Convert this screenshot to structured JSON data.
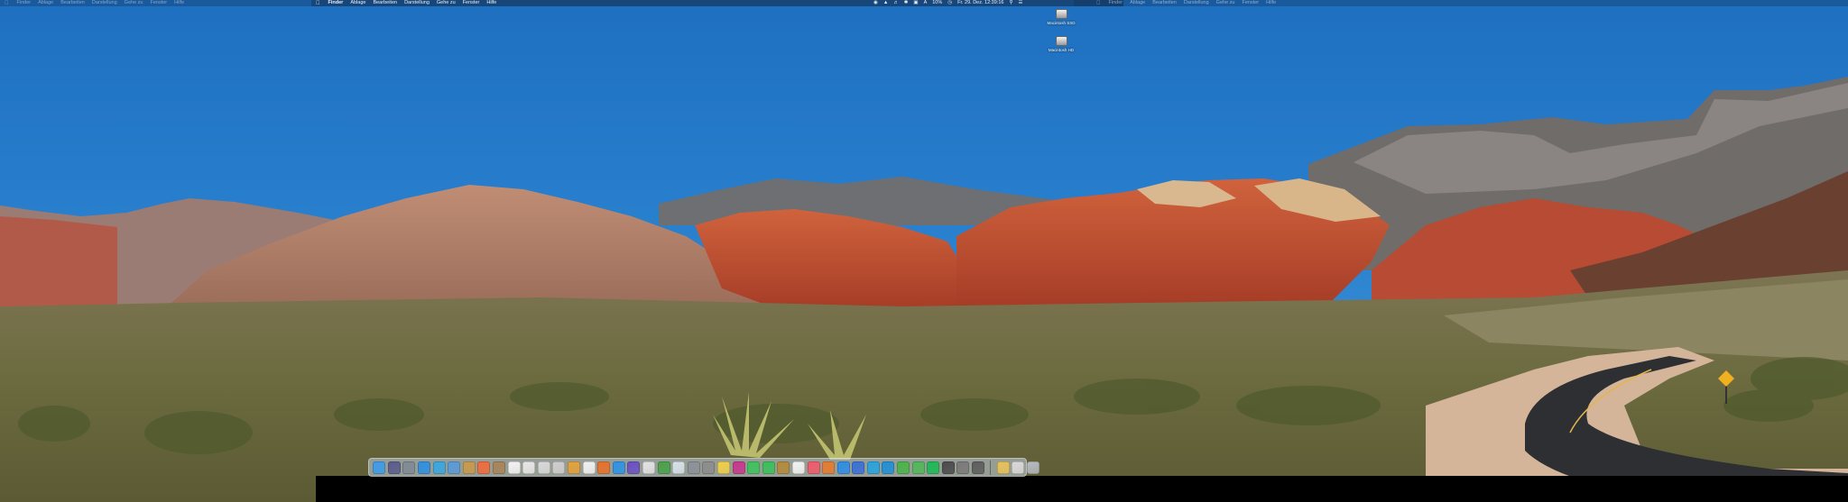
{
  "menubar": {
    "app_menu": "Finder",
    "items": [
      "Ablage",
      "Bearbeiten",
      "Darstellung",
      "Gehe zu",
      "Fenster",
      "Hilfe"
    ],
    "status": {
      "battery": "10%",
      "datetime": "Fr. 29. Dez. 12:39:16",
      "input": "A"
    }
  },
  "desktop": {
    "drives": [
      {
        "label": "Macintosh SSD",
        "icon": "hard-drive-icon"
      },
      {
        "label": "Macintosh HD",
        "icon": "hard-drive-icon"
      }
    ]
  },
  "dock": {
    "apps": [
      {
        "name": "finder",
        "color": "#3d9be9"
      },
      {
        "name": "siri",
        "color": "#5b5b8a"
      },
      {
        "name": "launchpad",
        "color": "#7f8a96"
      },
      {
        "name": "safari",
        "color": "#2f8fe0"
      },
      {
        "name": "safari-2",
        "color": "#3aa6df"
      },
      {
        "name": "mail",
        "color": "#5a9ad8"
      },
      {
        "name": "contacts",
        "color": "#c89a4c"
      },
      {
        "name": "reminders",
        "color": "#f06b3c"
      },
      {
        "name": "notes",
        "color": "#a8845a"
      },
      {
        "name": "calendar",
        "color": "#f4f4f4"
      },
      {
        "name": "textedit",
        "color": "#e8e8e8"
      },
      {
        "name": "preview",
        "color": "#dadada"
      },
      {
        "name": "documents",
        "color": "#cfcfcf"
      },
      {
        "name": "chrome",
        "color": "#e4a13a"
      },
      {
        "name": "browser",
        "color": "#f2f2f2"
      },
      {
        "name": "firefox",
        "color": "#e8702a"
      },
      {
        "name": "weather",
        "color": "#2e92e6"
      },
      {
        "name": "imovie",
        "color": "#6a4fc4"
      },
      {
        "name": "keynote",
        "color": "#e3e3e3"
      },
      {
        "name": "numbers",
        "color": "#49a14a"
      },
      {
        "name": "photo-booth",
        "color": "#d9e2ea"
      },
      {
        "name": "screenshot",
        "color": "#8b9198"
      },
      {
        "name": "mac-icon",
        "color": "#8c8c8c"
      },
      {
        "name": "photos",
        "color": "#f0d04a"
      },
      {
        "name": "photos-2",
        "color": "#c8368c"
      },
      {
        "name": "messages",
        "color": "#3fc25e"
      },
      {
        "name": "facetime",
        "color": "#3ac05b"
      },
      {
        "name": "maps",
        "color": "#b48a3a"
      },
      {
        "name": "itunes",
        "color": "#f3f3f3"
      },
      {
        "name": "music",
        "color": "#f15a6b"
      },
      {
        "name": "books",
        "color": "#e67b2e"
      },
      {
        "name": "app-store",
        "color": "#2e8de6"
      },
      {
        "name": "xcode",
        "color": "#3a6fd8"
      },
      {
        "name": "system-prefs",
        "color": "#27a3e0"
      },
      {
        "name": "skype",
        "color": "#1f8fd6"
      },
      {
        "name": "growl",
        "color": "#4ab34a"
      },
      {
        "name": "evernote",
        "color": "#52b75a"
      },
      {
        "name": "spotify",
        "color": "#1db954"
      },
      {
        "name": "terminal",
        "color": "#4a4a4a"
      },
      {
        "name": "settings",
        "color": "#7a7a7a"
      },
      {
        "name": "activity",
        "color": "#5c5c5c"
      }
    ],
    "right": [
      {
        "name": "downloads-stack",
        "color": "#e8c25a"
      },
      {
        "name": "documents-stack",
        "color": "#d9d9d9"
      },
      {
        "name": "trash",
        "color": "#b8bcc2"
      }
    ]
  }
}
